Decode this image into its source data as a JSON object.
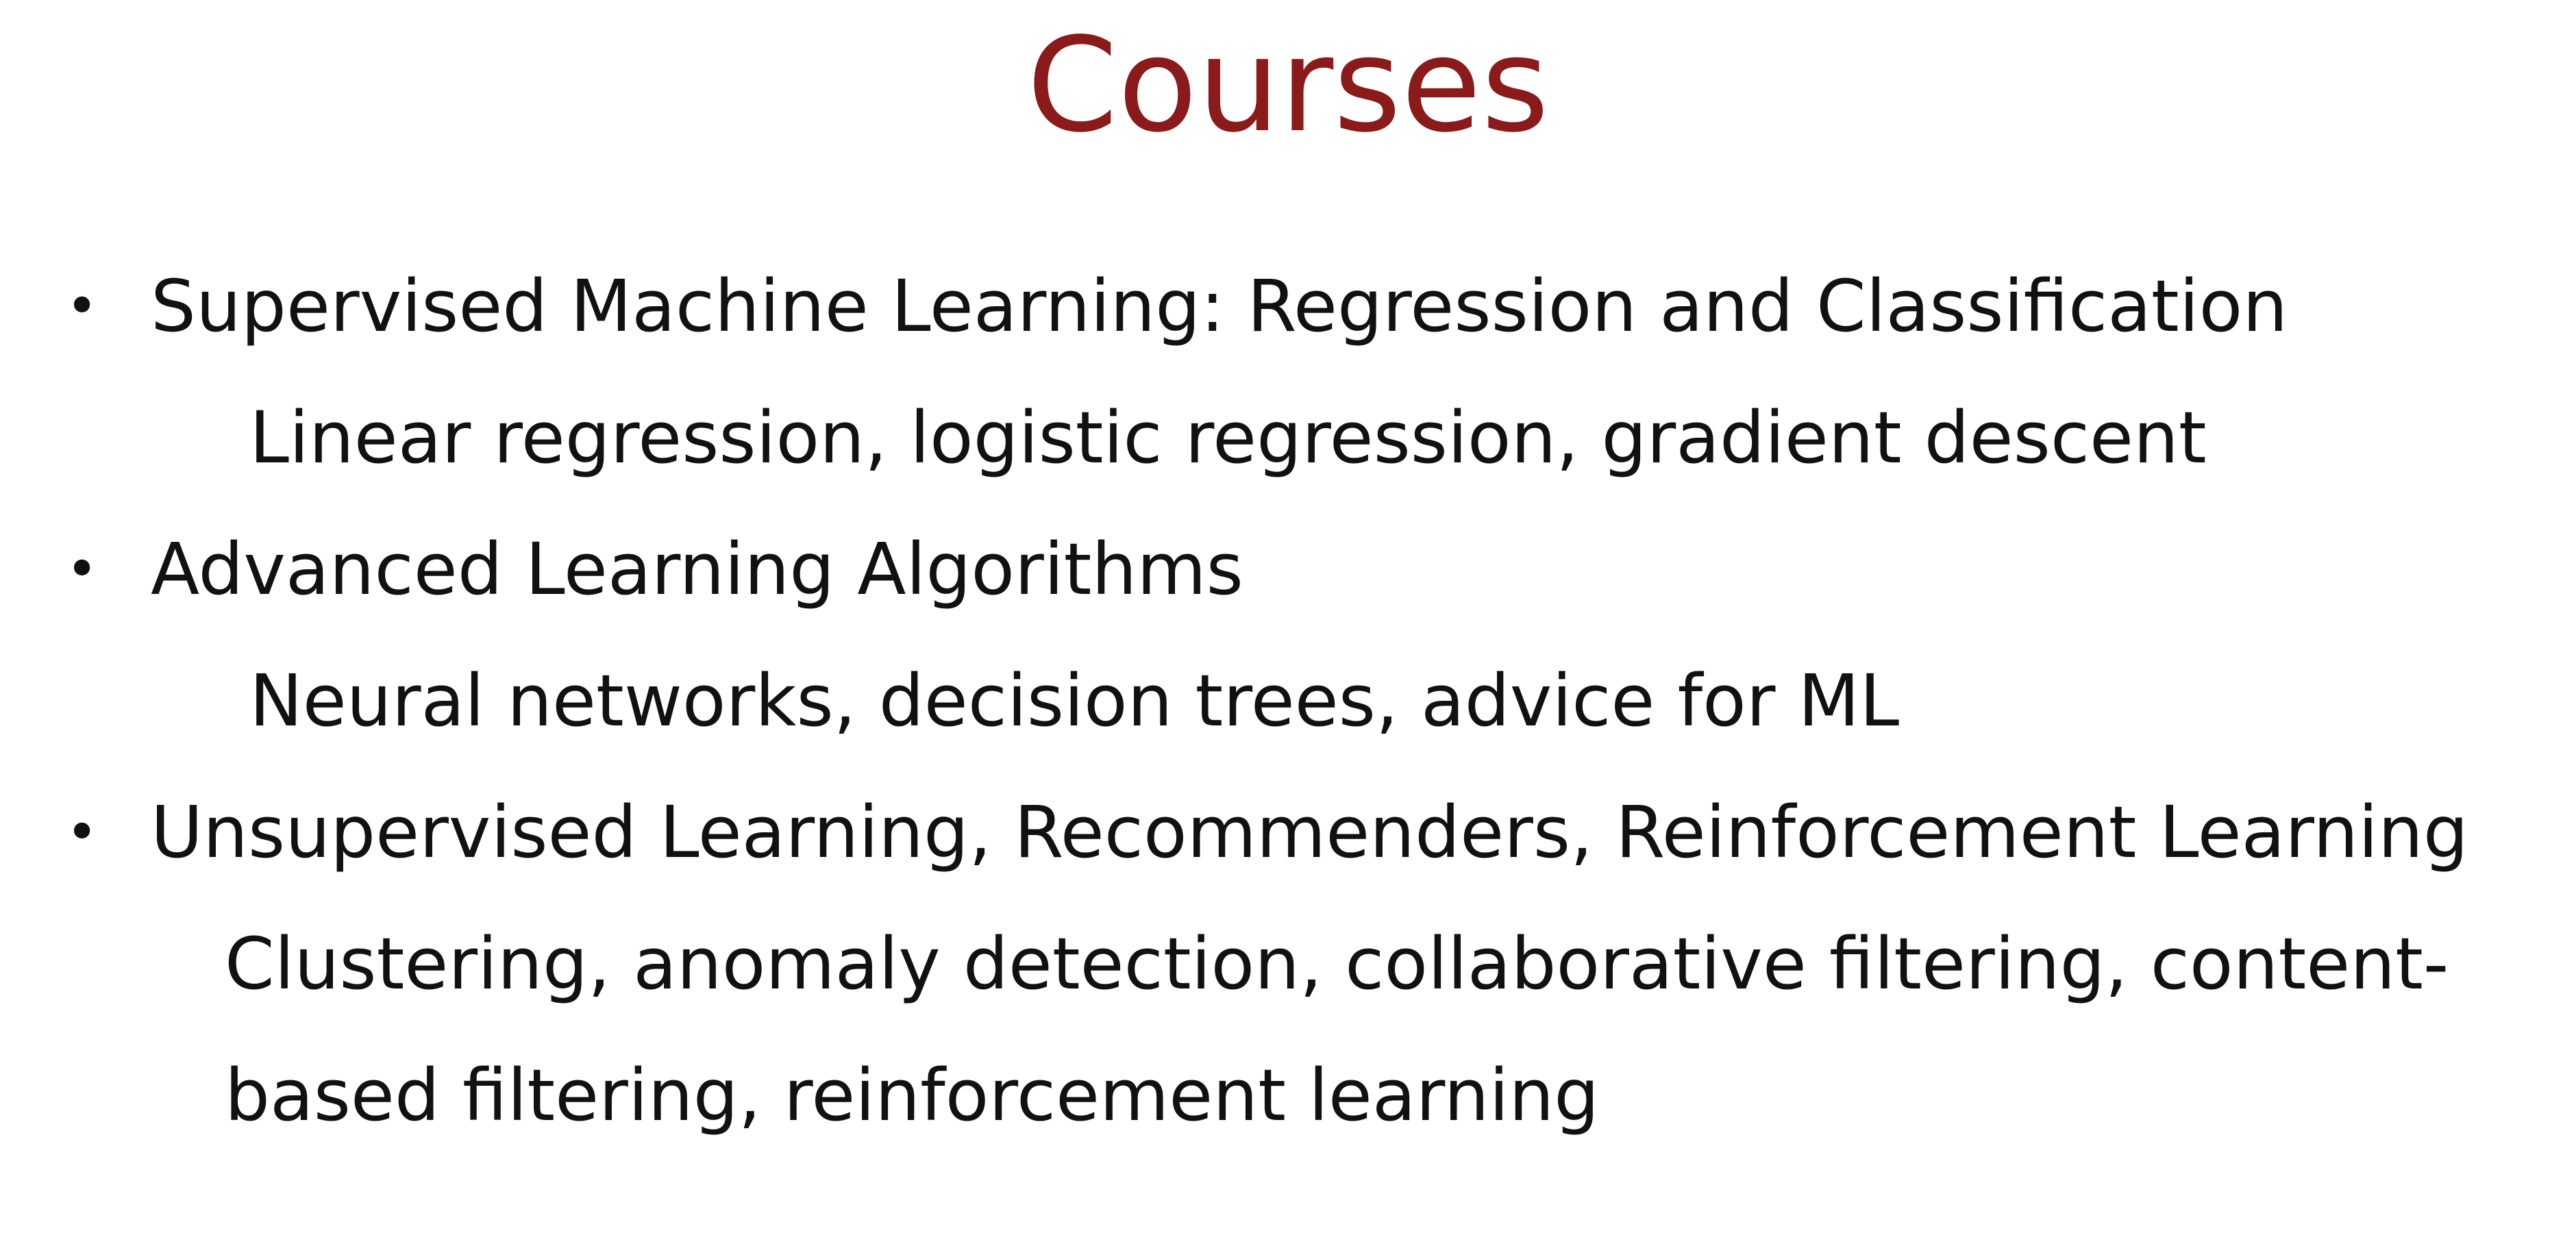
{
  "slide": {
    "title": "Courses",
    "bullet_glyph": "•",
    "courses": [
      {
        "name": "Supervised Machine Learning: Regression and Classification",
        "topics": [
          "Linear regression, logistic regression, gradient descent"
        ]
      },
      {
        "name": "Advanced Learning Algorithms",
        "topics": [
          "Neural networks, decision trees, advice for ML"
        ]
      },
      {
        "name": "Unsupervised Learning, Recommenders, Reinforcement Learning",
        "topics": [
          "Clustering, anomaly detection, collaborative filtering, content-",
          "based filtering, reinforcement learning"
        ]
      }
    ],
    "colors": {
      "title": "#8b1a1a",
      "text": "#111111",
      "background": "#ffffff"
    }
  }
}
